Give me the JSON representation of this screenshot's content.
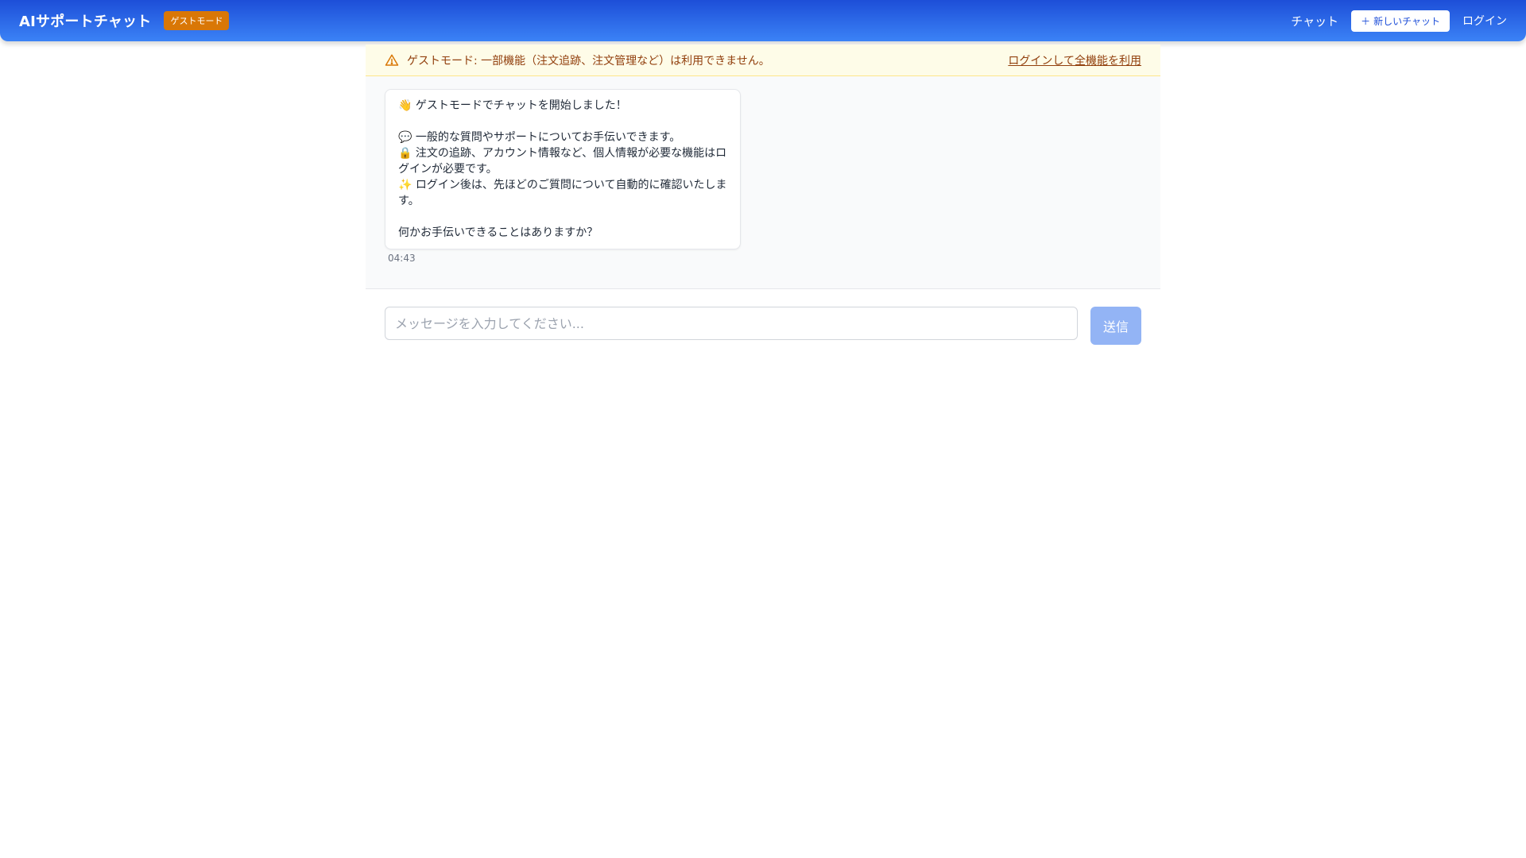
{
  "header": {
    "title": "AIサポートチャット",
    "guest_badge": "ゲストモード",
    "nav_chat": "チャット",
    "new_chat_label": "新しいチャット",
    "new_chat_icon": "plus-icon",
    "login": "ログイン"
  },
  "warning": {
    "icon": "warning-icon",
    "message": "ゲストモード: 一部機能（注文追跡、注文管理など）は利用できません。",
    "link": "ログインして全機能を利用"
  },
  "chat": {
    "messages": [
      {
        "lines": [
          "👋 ゲストモードでチャットを開始しました！",
          "",
          "💬 一般的な質問やサポートについてお手伝いできます。",
          "🔒 注文の追跡、アカウント情報など、個人情報が必要な機能はログインが必要です。",
          "✨ ログイン後は、先ほどのご質問について自動的に確認いたします。",
          "",
          "何かお手伝いできることはありますか？"
        ],
        "time": "04:43"
      }
    ]
  },
  "composer": {
    "placeholder": "メッセージを入力してください...",
    "send_label": "送信"
  },
  "colors": {
    "header_start": "#1d4ed8",
    "header_end": "#3b82f6",
    "badge": "#d97706",
    "warning_bg": "#fefce8",
    "warning_text": "#92400e",
    "send_disabled": "#93b4f5"
  }
}
